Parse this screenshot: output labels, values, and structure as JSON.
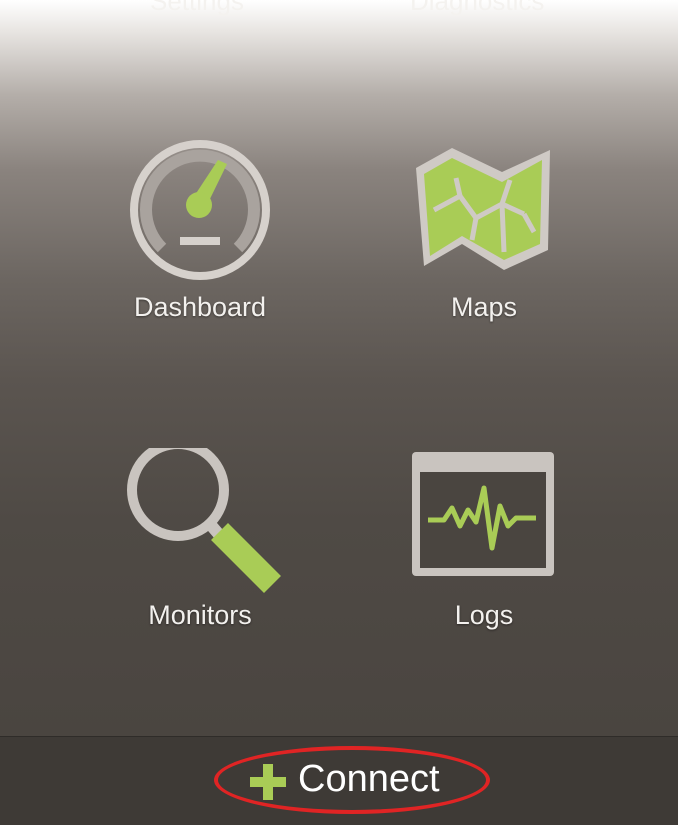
{
  "header": {
    "left_label": "Settings",
    "right_label": "Diagnostics"
  },
  "tiles": [
    {
      "label": "Dashboard",
      "icon": "speedometer-icon"
    },
    {
      "label": "Maps",
      "icon": "map-icon"
    },
    {
      "label": "Monitors",
      "icon": "magnifier-icon"
    },
    {
      "label": "Logs",
      "icon": "waveform-window-icon"
    }
  ],
  "bottom": {
    "connect_label": "Connect",
    "icon": "plus-icon"
  },
  "colors": {
    "accent_green": "#a9cc56",
    "icon_gray": "#c9c4bf",
    "highlight_red": "#e02424"
  }
}
